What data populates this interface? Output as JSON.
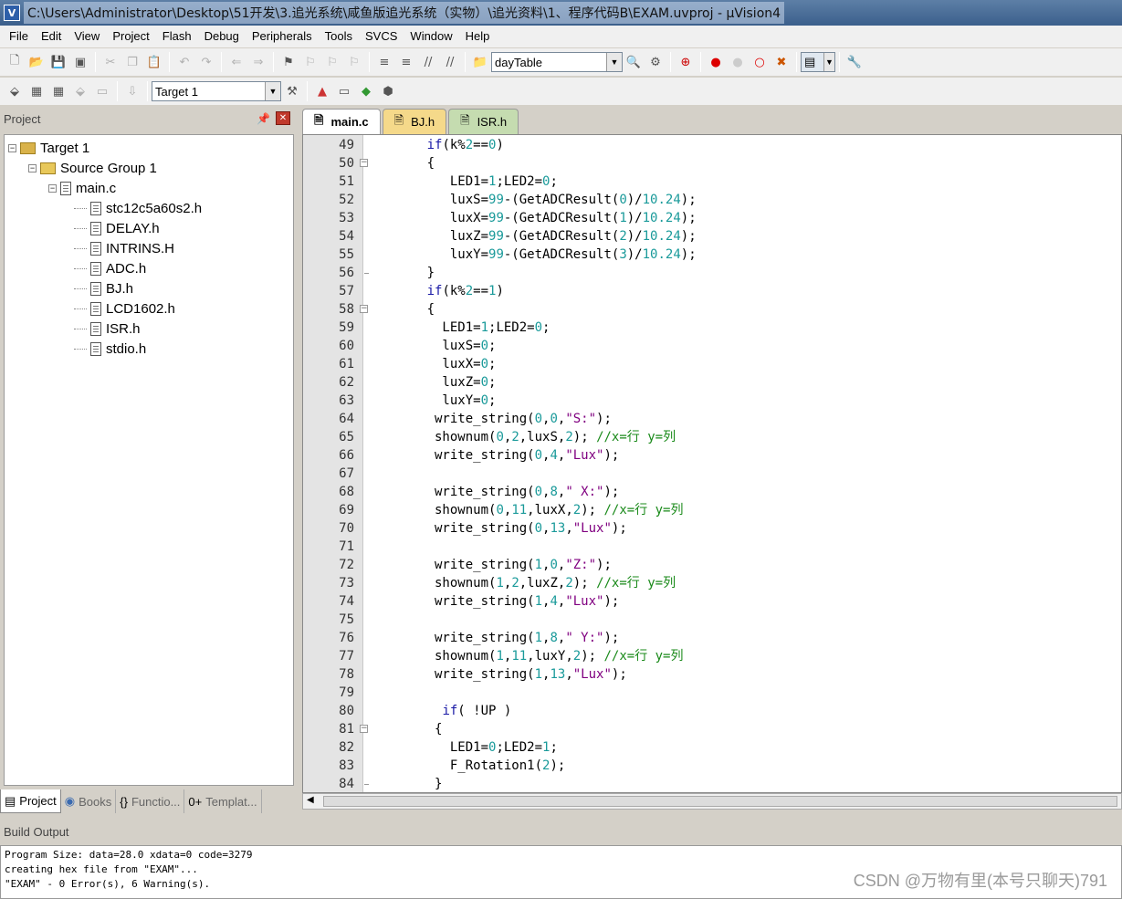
{
  "window": {
    "title": "C:\\Users\\Administrator\\Desktop\\51开发\\3.追光系统\\咸鱼版追光系统（实物）\\追光资料\\1、程序代码B\\EXAM.uvproj - µVision4"
  },
  "menu": [
    "File",
    "Edit",
    "View",
    "Project",
    "Flash",
    "Debug",
    "Peripherals",
    "Tools",
    "SVCS",
    "Window",
    "Help"
  ],
  "toolbar": {
    "find_combo": "dayTable",
    "target_combo": "Target 1"
  },
  "project": {
    "title": "Project",
    "tree": [
      {
        "label": "Target 1",
        "level": 0,
        "kind": "target"
      },
      {
        "label": "Source Group 1",
        "level": 1,
        "kind": "group"
      },
      {
        "label": "main.c",
        "level": 2,
        "kind": "file"
      },
      {
        "label": "stc12c5a60s2.h",
        "level": 3,
        "kind": "file"
      },
      {
        "label": "DELAY.h",
        "level": 3,
        "kind": "file"
      },
      {
        "label": "INTRINS.H",
        "level": 3,
        "kind": "file"
      },
      {
        "label": "ADC.h",
        "level": 3,
        "kind": "file"
      },
      {
        "label": "BJ.h",
        "level": 3,
        "kind": "file"
      },
      {
        "label": "LCD1602.h",
        "level": 3,
        "kind": "file"
      },
      {
        "label": "ISR.h",
        "level": 3,
        "kind": "file"
      },
      {
        "label": "stdio.h",
        "level": 3,
        "kind": "file"
      }
    ],
    "tabs": [
      "Project",
      "Books",
      "Functio...",
      "Templat..."
    ]
  },
  "editor": {
    "tabs": [
      "main.c",
      "BJ.h",
      "ISR.h"
    ],
    "lines": [
      {
        "n": "49",
        "code": "      if(k%2==0)"
      },
      {
        "n": "50",
        "code": "      {"
      },
      {
        "n": "51",
        "code": "         LED1=1;LED2=0;"
      },
      {
        "n": "52",
        "code": "         luxS=99-(GetADCResult(0)/10.24);"
      },
      {
        "n": "53",
        "code": "         luxX=99-(GetADCResult(1)/10.24);"
      },
      {
        "n": "54",
        "code": "         luxZ=99-(GetADCResult(2)/10.24);"
      },
      {
        "n": "55",
        "code": "         luxY=99-(GetADCResult(3)/10.24);"
      },
      {
        "n": "56",
        "code": "      }"
      },
      {
        "n": "57",
        "code": "      if(k%2==1)"
      },
      {
        "n": "58",
        "code": "      {"
      },
      {
        "n": "59",
        "code": "        LED1=1;LED2=0;"
      },
      {
        "n": "60",
        "code": "        luxS=0;"
      },
      {
        "n": "61",
        "code": "        luxX=0;"
      },
      {
        "n": "62",
        "code": "        luxZ=0;"
      },
      {
        "n": "63",
        "code": "        luxY=0;"
      },
      {
        "n": "64",
        "code": "       write_string(0,0,\"S:\");"
      },
      {
        "n": "65",
        "code": "       shownum(0,2,luxS,2); //x=行 y=列"
      },
      {
        "n": "66",
        "code": "       write_string(0,4,\"Lux\");"
      },
      {
        "n": "67",
        "code": ""
      },
      {
        "n": "68",
        "code": "       write_string(0,8,\" X:\");"
      },
      {
        "n": "69",
        "code": "       shownum(0,11,luxX,2); //x=行 y=列"
      },
      {
        "n": "70",
        "code": "       write_string(0,13,\"Lux\");"
      },
      {
        "n": "71",
        "code": ""
      },
      {
        "n": "72",
        "code": "       write_string(1,0,\"Z:\");"
      },
      {
        "n": "73",
        "code": "       shownum(1,2,luxZ,2); //x=行 y=列"
      },
      {
        "n": "74",
        "code": "       write_string(1,4,\"Lux\");"
      },
      {
        "n": "75",
        "code": ""
      },
      {
        "n": "76",
        "code": "       write_string(1,8,\" Y:\");"
      },
      {
        "n": "77",
        "code": "       shownum(1,11,luxY,2); //x=行 y=列"
      },
      {
        "n": "78",
        "code": "       write_string(1,13,\"Lux\");"
      },
      {
        "n": "79",
        "code": ""
      },
      {
        "n": "80",
        "code": "        if( !UP )"
      },
      {
        "n": "81",
        "code": "       {"
      },
      {
        "n": "82",
        "code": "         LED1=0;LED2=1;"
      },
      {
        "n": "83",
        "code": "         F_Rotation1(2);"
      },
      {
        "n": "84",
        "code": "       }"
      }
    ]
  },
  "build": {
    "title": "Build Output",
    "lines": [
      "Program Size: data=28.0 xdata=0 code=3279",
      "creating hex file from \"EXAM\"...",
      "\"EXAM\" - 0 Error(s), 6 Warning(s)."
    ]
  },
  "watermark": "CSDN @万物有里(本号只聊天)791"
}
